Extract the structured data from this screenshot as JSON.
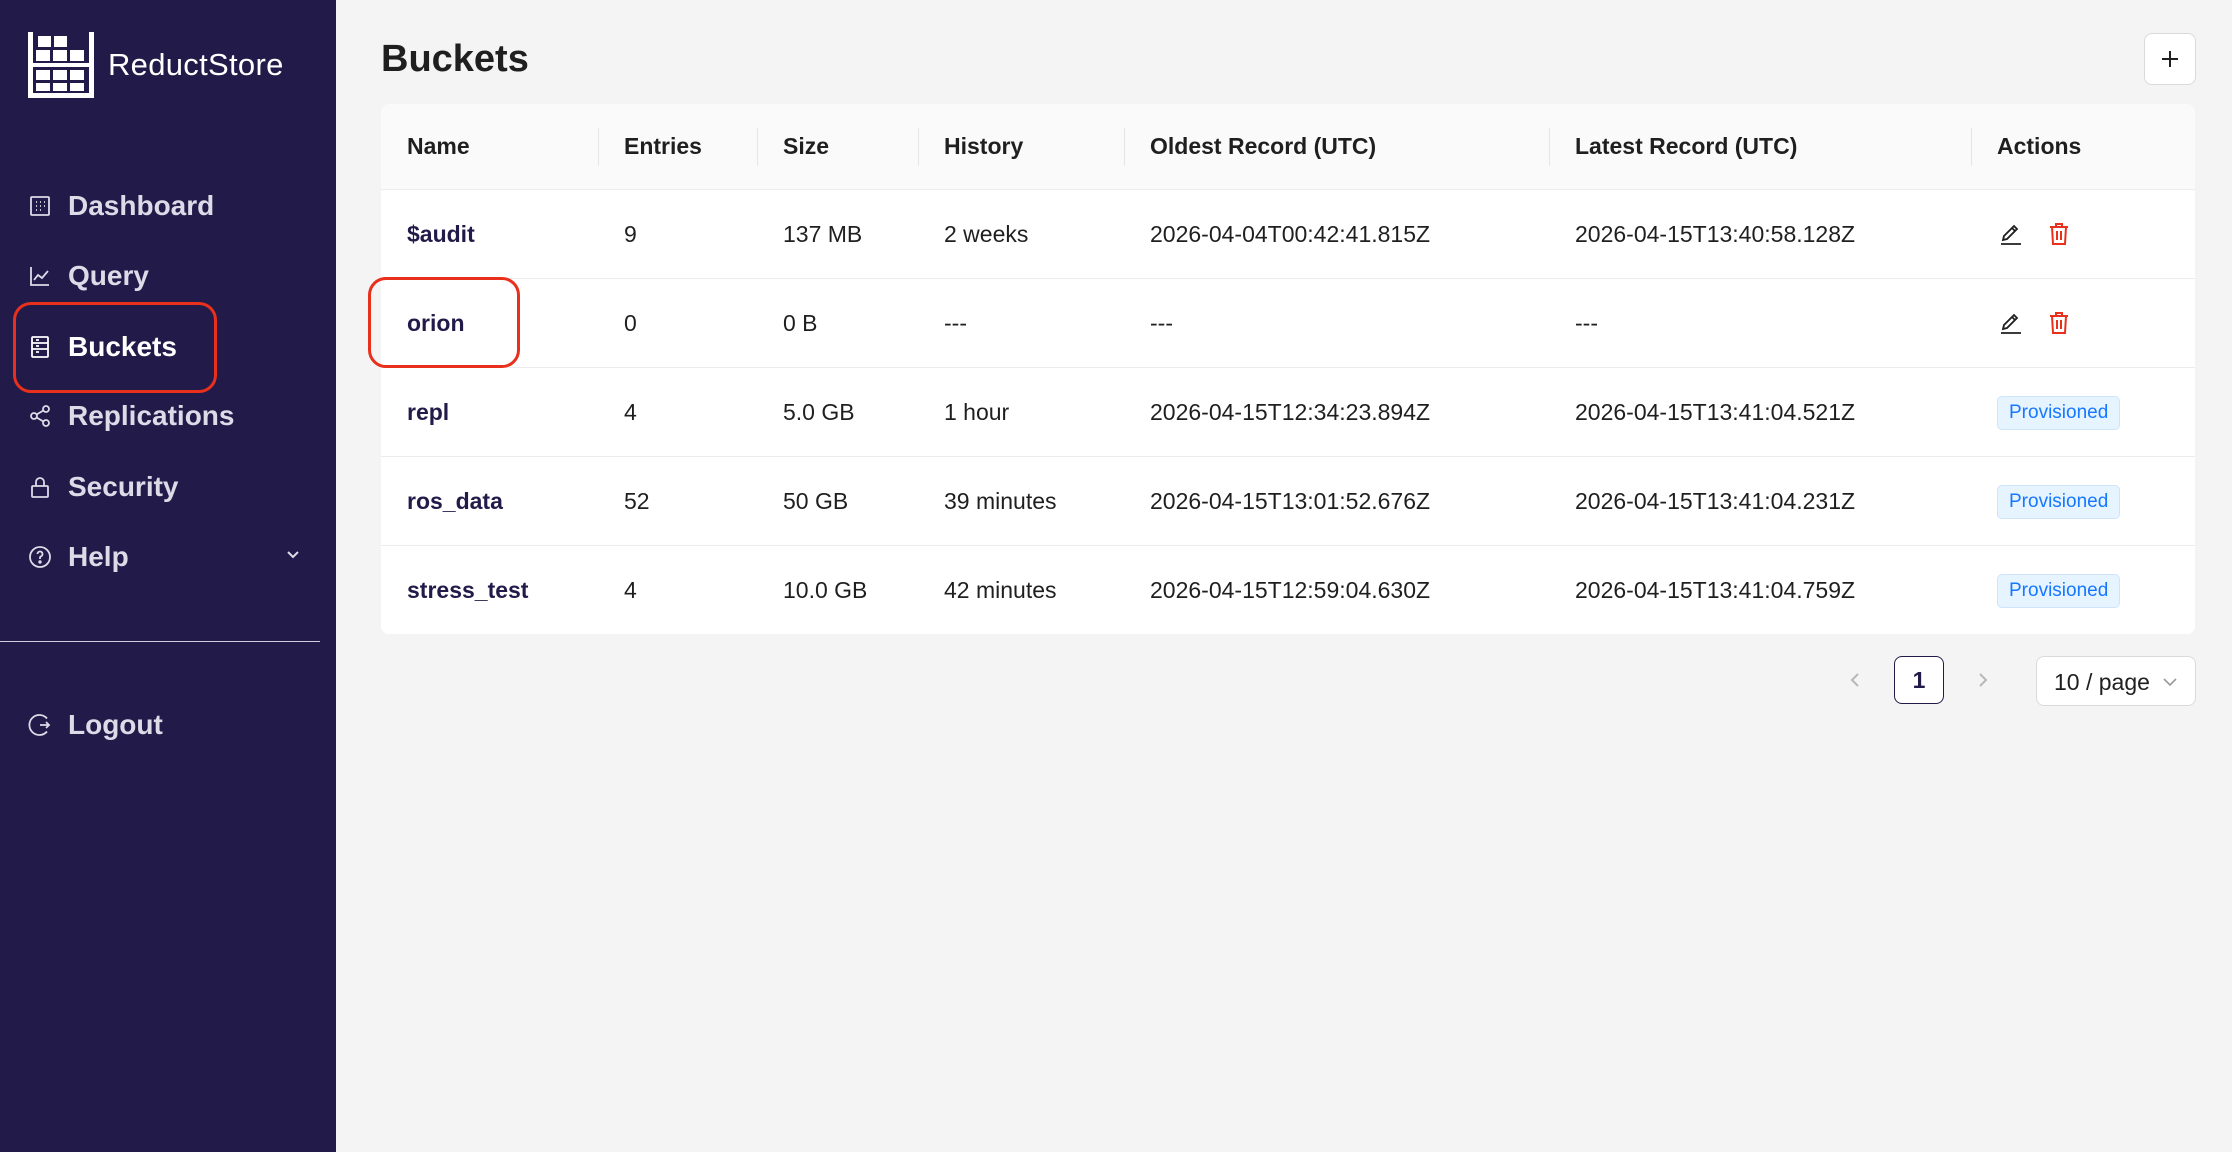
{
  "brand": {
    "name": "ReductStore"
  },
  "sidebar": {
    "items": [
      {
        "label": "Dashboard",
        "icon": "dashboard-icon"
      },
      {
        "label": "Query",
        "icon": "chart-line-icon"
      },
      {
        "label": "Buckets",
        "icon": "database-icon",
        "active": true
      },
      {
        "label": "Replications",
        "icon": "share-icon"
      },
      {
        "label": "Security",
        "icon": "lock-icon"
      },
      {
        "label": "Help",
        "icon": "question-circle-icon"
      }
    ],
    "logout": {
      "label": "Logout",
      "icon": "logout-icon"
    }
  },
  "main": {
    "title": "Buckets",
    "add_button": "plus-icon",
    "columns": [
      "Name",
      "Entries",
      "Size",
      "History",
      "Oldest Record (UTC)",
      "Latest Record (UTC)",
      "Actions"
    ],
    "rows": [
      {
        "name": "$audit",
        "entries": "9",
        "size": "137 MB",
        "history": "2 weeks",
        "oldest": "2026-04-04T00:42:41.815Z",
        "latest": "2026-04-15T13:40:58.128Z",
        "actions": "edit-delete"
      },
      {
        "name": "orion",
        "entries": "0",
        "size": "0 B",
        "history": "---",
        "oldest": "---",
        "latest": "---",
        "actions": "edit-delete"
      },
      {
        "name": "repl",
        "entries": "4",
        "size": "5.0 GB",
        "history": "1 hour",
        "oldest": "2026-04-15T12:34:23.894Z",
        "latest": "2026-04-15T13:41:04.521Z",
        "actions": "Provisioned"
      },
      {
        "name": "ros_data",
        "entries": "52",
        "size": "50 GB",
        "history": "39 minutes",
        "oldest": "2026-04-15T13:01:52.676Z",
        "latest": "2026-04-15T13:41:04.231Z",
        "actions": "Provisioned"
      },
      {
        "name": "stress_test",
        "entries": "4",
        "size": "10.0 GB",
        "history": "42 minutes",
        "oldest": "2026-04-15T12:59:04.630Z",
        "latest": "2026-04-15T13:41:04.759Z",
        "actions": "Provisioned"
      }
    ]
  },
  "pagination": {
    "current_page": "1",
    "page_size": "10 / page"
  },
  "colors": {
    "sidebar_bg": "#221b4a",
    "accent": "#221b4a",
    "danger": "#e8301c",
    "tag_blue": "#1677ff",
    "annotation": "#e8301c"
  }
}
